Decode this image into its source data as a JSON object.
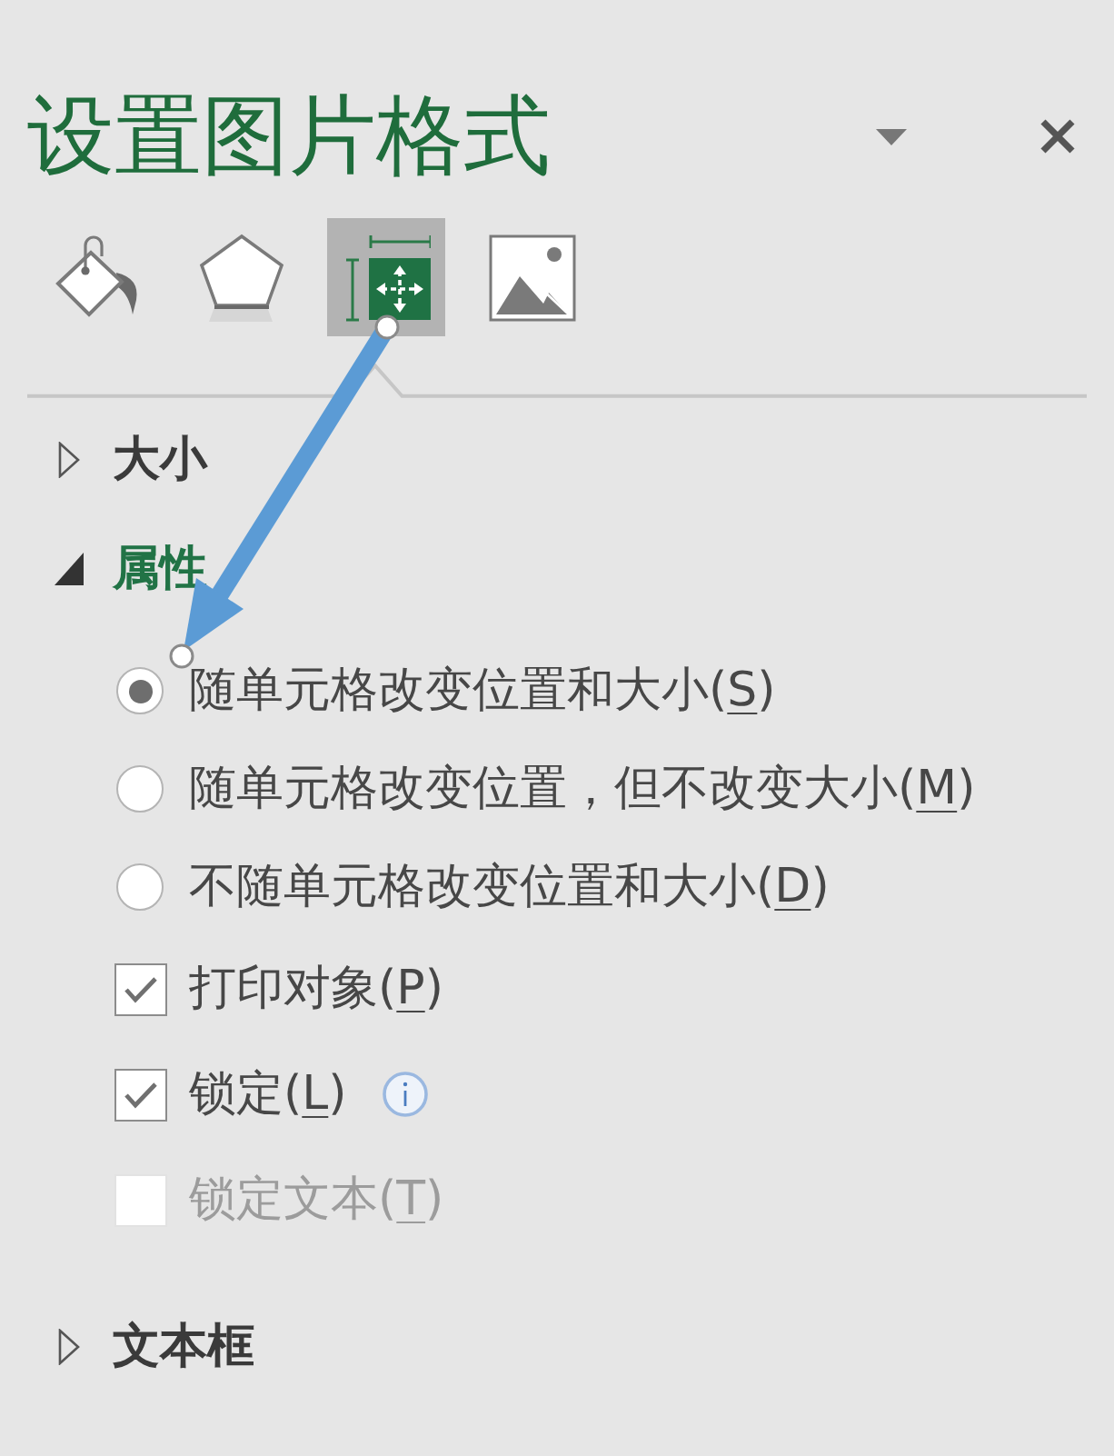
{
  "title": "设置图片格式",
  "tabs": [
    {
      "kind": "fill",
      "selected": false
    },
    {
      "kind": "effects",
      "selected": false
    },
    {
      "kind": "layout",
      "selected": true
    },
    {
      "kind": "picture",
      "selected": false
    }
  ],
  "sections": [
    {
      "title": "大小",
      "expanded": false
    },
    {
      "title": "属性",
      "expanded": true,
      "options": [
        {
          "kind": "radio",
          "label": "随单元格改变位置和大小(",
          "access_key": "S",
          "label_end": ")",
          "selected": true,
          "disabled": false
        },
        {
          "kind": "radio",
          "label": "随单元格改变位置，但不改变大小(",
          "access_key": "M",
          "label_end": ")",
          "selected": false,
          "disabled": false
        },
        {
          "kind": "radio",
          "label": "不随单元格改变位置和大小(",
          "access_key": "D",
          "label_end": ")",
          "selected": false,
          "disabled": false
        },
        {
          "kind": "checkbox",
          "label": "打印对象(",
          "access_key": "P",
          "label_end": ")",
          "checked": true,
          "disabled": false
        },
        {
          "kind": "checkbox",
          "label": "锁定(",
          "access_key": "L",
          "label_end": ")",
          "checked": true,
          "disabled": false,
          "info": true
        },
        {
          "kind": "checkbox",
          "label": "锁定文本(",
          "access_key": "T",
          "label_end": ")",
          "checked": false,
          "disabled": true
        }
      ]
    },
    {
      "title": "文本框",
      "expanded": false
    }
  ]
}
